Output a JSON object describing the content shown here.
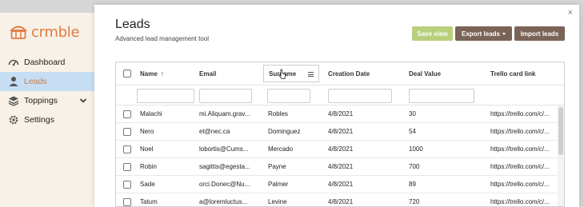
{
  "brand": {
    "name": "crmble",
    "color": "#e07a3f"
  },
  "nav": [
    {
      "label": "Dashboard",
      "icon": "dashboard-icon",
      "active": false
    },
    {
      "label": "Leads",
      "icon": "user-icon",
      "active": true
    },
    {
      "label": "Toppings",
      "icon": "layers-icon",
      "active": false,
      "expandable": true
    },
    {
      "label": "Settings",
      "icon": "gear-icon",
      "active": false
    }
  ],
  "modal": {
    "title": "Leads",
    "subtitle": "Advanced lead management tool",
    "close_label": "×",
    "buttons": {
      "save": "Save view",
      "export": "Export leads",
      "import": "Import leads"
    }
  },
  "grid": {
    "columns": [
      "Name",
      "Email",
      "Surname",
      "Creation Date",
      "Deal Value",
      "Trello card link"
    ],
    "sort_indicator": "↑",
    "rows": [
      [
        "Malachi",
        "mi.Aliquam.grav...",
        "Robles",
        "4/8/2021",
        "30",
        "https://trello.com/c/..."
      ],
      [
        "Nero",
        "et@nec.ca",
        "Dominguez",
        "4/8/2021",
        "54",
        "https://trello.com/c/..."
      ],
      [
        "Noel",
        "lobortis@Cums...",
        "Mercado",
        "4/8/2021",
        "1000",
        "https://trello.com/c/..."
      ],
      [
        "Robin",
        "sagittis@egesta...",
        "Payne",
        "4/8/2021",
        "700",
        "https://trello.com/c/..."
      ],
      [
        "Sade",
        "orci.Donec@Nu...",
        "Palmer",
        "4/8/2021",
        "89",
        "https://trello.com/c/..."
      ],
      [
        "Tatum",
        "a@loremluctus...",
        "Levine",
        "4/8/2021",
        "720",
        "https://trello.com/c/..."
      ]
    ]
  },
  "colors": {
    "button_primary": "#b9cf7c",
    "button_secondary": "#7a6457",
    "active_nav_bg": "#c6def3",
    "sidebar_bg": "#f7f1e7"
  }
}
